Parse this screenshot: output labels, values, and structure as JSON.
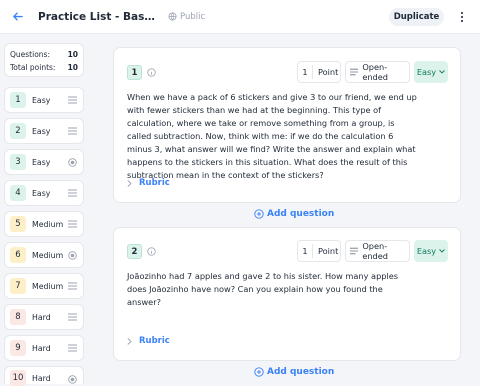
{
  "header": {
    "title": "Practice List - Basic Subtra...",
    "visibility": "Public",
    "duplicate_label": "Duplicate"
  },
  "summary": {
    "questions_label": "Questions:",
    "questions_value": "10",
    "points_label": "Total points:",
    "points_value": "10"
  },
  "question_list": [
    {
      "number": "1",
      "difficulty": "Easy",
      "icon": "lines-icon"
    },
    {
      "number": "2",
      "difficulty": "Easy",
      "icon": "lines-icon"
    },
    {
      "number": "3",
      "difficulty": "Easy",
      "icon": "radio-icon"
    },
    {
      "number": "4",
      "difficulty": "Easy",
      "icon": "lines-icon"
    },
    {
      "number": "5",
      "difficulty": "Medium",
      "icon": "lines-icon"
    },
    {
      "number": "6",
      "difficulty": "Medium",
      "icon": "radio-icon"
    },
    {
      "number": "7",
      "difficulty": "Medium",
      "icon": "lines-icon"
    },
    {
      "number": "8",
      "difficulty": "Hard",
      "icon": "lines-icon"
    },
    {
      "number": "9",
      "difficulty": "Hard",
      "icon": "lines-icon"
    },
    {
      "number": "10",
      "difficulty": "Hard",
      "icon": "radio-icon"
    }
  ],
  "questions": [
    {
      "number": "1",
      "points": "1",
      "points_label": "Point",
      "type": "Open-ended",
      "difficulty": "Easy",
      "text": "When we have a pack of 6 stickers and give 3 to our friend, we end up with fewer stickers than we had at the beginning. This type of calculation, where we take or remove something from a group, is called subtraction. Now, think with me: if we do the calculation 6 minus 3, what answer will we find? Write the answer and explain what happens to the stickers in this situation. What does the result of this subtraction mean in the context of the stickers?",
      "rubric_label": "Rubric"
    },
    {
      "number": "2",
      "points": "1",
      "points_label": "Point",
      "type": "Open-ended",
      "difficulty": "Easy",
      "text": "Joãozinho had 7 apples and gave 2 to his sister. How many apples does Joãozinho have now? Can you explain how you found the answer?",
      "rubric_label": "Rubric"
    }
  ],
  "add_question_label": "Add question",
  "colors": {
    "accent": "#3b82f6",
    "easy": "#dcf3ec",
    "medium": "#fdf0c8",
    "hard": "#fbe7e3",
    "easy_text": "#0f7a5c"
  }
}
